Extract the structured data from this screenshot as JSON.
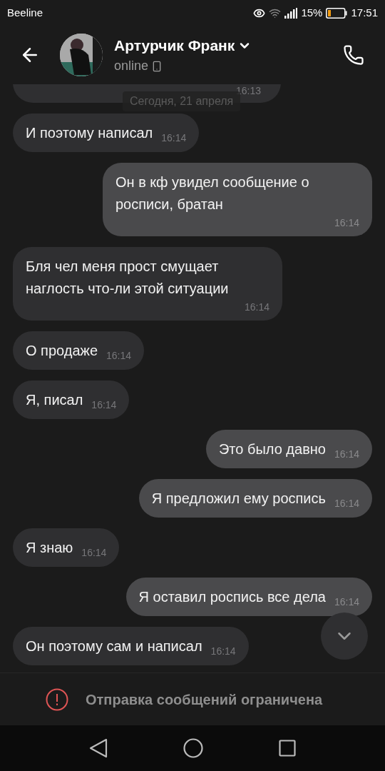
{
  "status_bar": {
    "carrier": "Beeline",
    "battery": "15%",
    "time": "17:51"
  },
  "header": {
    "name": "Артурчик Франк",
    "status": "online"
  },
  "date_pill": "Сегодня, 21 апреля",
  "messages": [
    {
      "outgoing": false,
      "kind": "cut",
      "time": "16:13"
    },
    {
      "outgoing": false,
      "kind": "inline",
      "text": "И поэтому написал",
      "time": "16:14"
    },
    {
      "outgoing": true,
      "kind": "block",
      "text": "Он в кф увидел сообщение о росписи, братан",
      "time": "16:14"
    },
    {
      "outgoing": false,
      "kind": "block",
      "text": "Бля чел меня прост смущает наглость что-ли этой ситуации",
      "time": "16:14"
    },
    {
      "outgoing": false,
      "kind": "inline",
      "text": "О продаже",
      "time": "16:14"
    },
    {
      "outgoing": false,
      "kind": "inline",
      "text": "Я, писал",
      "time": "16:14"
    },
    {
      "outgoing": true,
      "kind": "inline",
      "text": "Это было давно",
      "time": "16:14"
    },
    {
      "outgoing": true,
      "kind": "inline",
      "text": "Я предложил ему роспись",
      "time": "16:14"
    },
    {
      "outgoing": false,
      "kind": "inline",
      "text": "Я знаю",
      "time": "16:14"
    },
    {
      "outgoing": true,
      "kind": "inline",
      "text": "Я оставил роспись все дела",
      "time": "16:14"
    },
    {
      "outgoing": false,
      "kind": "inline",
      "text": "Он поэтому сам и написал",
      "time": "16:14"
    }
  ],
  "restriction": "Отправка сообщений ограничена"
}
